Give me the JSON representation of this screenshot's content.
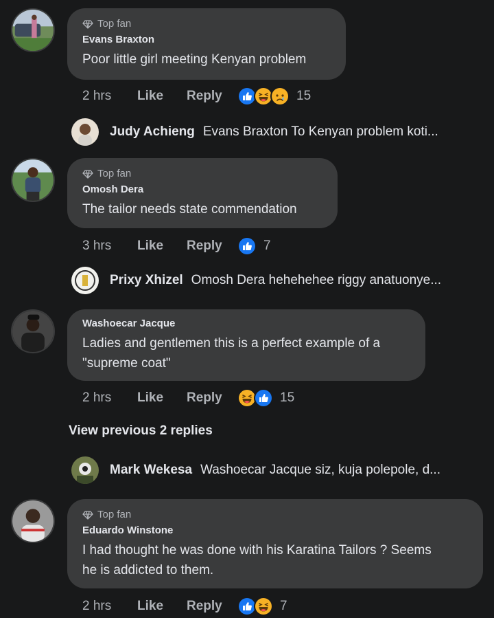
{
  "comments": [
    {
      "top_fan_label": "Top fan",
      "author": "Evans Braxton",
      "text": "Poor little girl meeting Kenyan problem",
      "time": "2 hrs",
      "like": "Like",
      "reply": "Reply",
      "reactions": [
        "like-icon",
        "laugh-icon",
        "sad-icon"
      ],
      "reaction_count": "15",
      "reply_preview": {
        "name": "Judy Achieng",
        "text": "Evans Braxton To Kenyan problem koti..."
      }
    },
    {
      "top_fan_label": "Top fan",
      "author": "Omosh Dera",
      "text": "The tailor needs state commendation",
      "time": "3 hrs",
      "like": "Like",
      "reply": "Reply",
      "reactions": [
        "like-icon"
      ],
      "reaction_count": "7",
      "reply_preview": {
        "name": "Prixy Xhizel",
        "text": "Omosh Dera hehehehee riggy anatuonye..."
      }
    },
    {
      "author": "Washoecar Jacque",
      "text_line1": "Ladies and gentlemen this is a perfect example of a",
      "text_line2": "\"supreme coat\"",
      "time": "2 hrs",
      "like": "Like",
      "reply": "Reply",
      "reactions": [
        "laugh-icon",
        "like-icon"
      ],
      "reaction_count": "15",
      "view_previous": "View previous 2 replies",
      "reply_preview": {
        "name": "Mark Wekesa",
        "text": "Washoecar Jacque siz, kuja polepole, d..."
      }
    },
    {
      "top_fan_label": "Top fan",
      "author": "Eduardo Winstone",
      "text_line1": "I had thought he was done with his Karatina Tailors ? Seems",
      "text_line2": "he is addicted to them.",
      "time": "2 hrs",
      "like": "Like",
      "reply": "Reply",
      "reactions": [
        "like-icon",
        "laugh-icon"
      ],
      "reaction_count": "7"
    }
  ],
  "colors": {
    "background": "#18191a",
    "bubble": "#3a3b3c",
    "like_blue": "#1877f2",
    "emoji_yellow": "#f7b125",
    "muted_text": "#b0b3b8"
  }
}
